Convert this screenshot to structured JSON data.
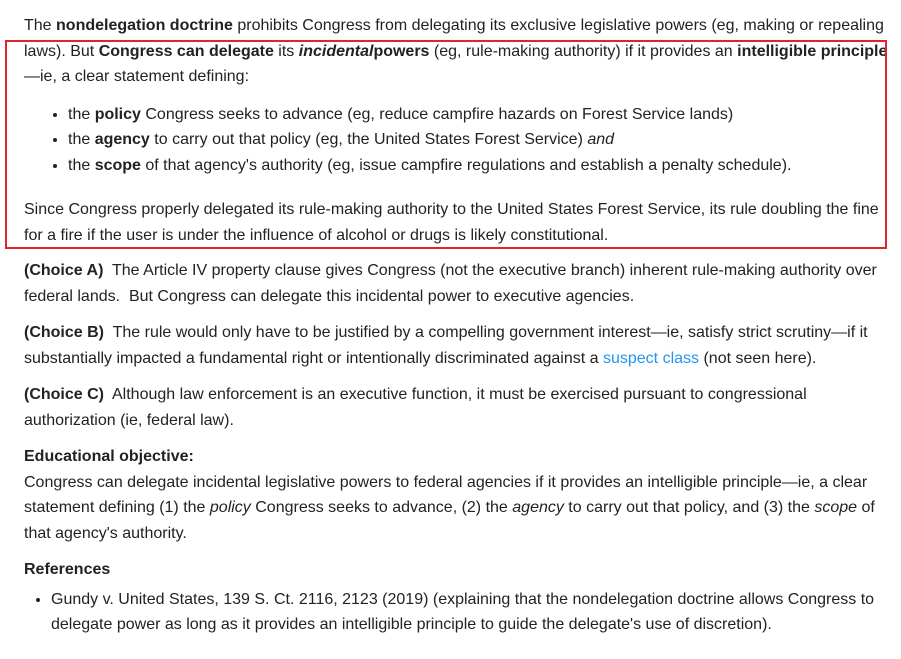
{
  "intro": {
    "s1": "The ",
    "b1": "nondelegation doctrine",
    "s2": " prohibits Congress from delegating its exclusive legislative powers (eg, making or repealing laws).  But ",
    "b2": "Congress can delegate",
    "s3": " its ",
    "bi": "incidental",
    "b3": "powers",
    "s4": " (eg, rule-making authority) if it provides an ",
    "b4": "intelligible principle",
    "s5": "—ie, a clear statement defining:"
  },
  "bullets": [
    {
      "pre": "the ",
      "bold": "policy",
      "post": " Congress seeks to advance (eg, reduce campfire hazards on Forest Service lands)"
    },
    {
      "pre": "the ",
      "bold": "agency",
      "post": " to carry out that policy (eg, the United States Forest Service) ",
      "italic": "and"
    },
    {
      "pre": "the ",
      "bold": "scope",
      "post": " of that agency's authority (eg, issue campfire regulations and establish a penalty schedule)."
    }
  ],
  "conclusion": "Since Congress properly delegated its rule-making authority to the United States Forest Service, its rule doubling the fine for a fire if the user is under the influence of alcohol or drugs is likely constitutional.",
  "choices": [
    {
      "label": "(Choice A)",
      "text": "  The Article IV property clause gives Congress (not the executive branch) inherent rule-making authority over federal lands.  But Congress can delegate this incidental power to executive agencies."
    },
    {
      "label": "(Choice B)",
      "text": "  The rule would only have to be justified by a compelling government interest—ie, satisfy strict scrutiny—if it substantially impacted a fundamental right or intentionally discriminated against a ",
      "link": "suspect class",
      "tail": " (not seen here)."
    },
    {
      "label": "(Choice C)",
      "text": "  Although law enforcement is an executive function, it must be exercised pursuant to congressional authorization (ie, federal law)."
    }
  ],
  "objective": {
    "heading": "Educational objective:",
    "t1": "Congress can delegate incidental legislative powers to federal agencies if it provides an intelligible principle—ie, a clear statement defining (1) the ",
    "i1": "policy",
    "t2": " Congress seeks to advance, (2) the ",
    "i2": "agency",
    "t3": " to carry out that policy, and (3) the ",
    "i3": "scope",
    "t4": " of that agency's authority."
  },
  "references": {
    "heading": "References",
    "items": [
      "Gundy v. United States, 139 S. Ct. 2116, 2123 (2019) (explaining that the nondelegation doctrine allows Congress to delegate power as long as it provides an intelligible principle to guide the delegate's use of discretion)."
    ]
  },
  "colors": {
    "highlight_border": "#e0242f",
    "link": "#2196f3"
  }
}
